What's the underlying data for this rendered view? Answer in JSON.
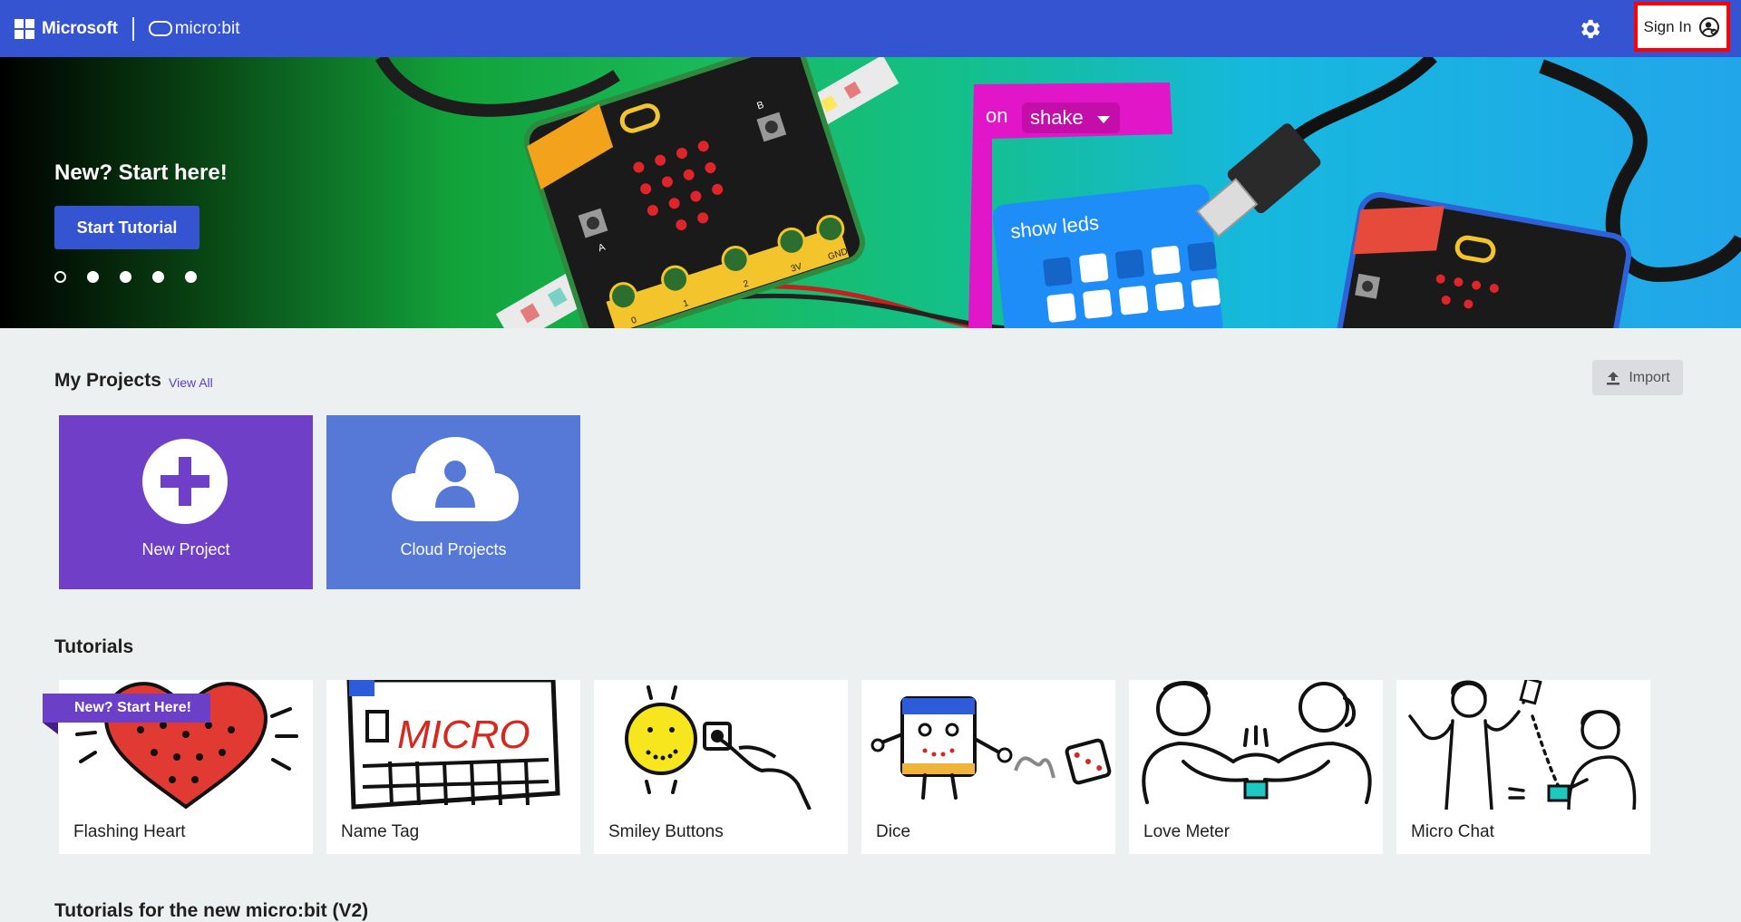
{
  "header": {
    "brand_microsoft": "Microsoft",
    "brand_product": "micro:bit",
    "settings_icon": "gear-icon",
    "signin_label": "Sign In",
    "signin_icon": "user-circle-icon",
    "bar_color": "#3454d1",
    "highlight_color": "#ff0000"
  },
  "hero": {
    "title": "New? Start here!",
    "button_label": "Start Tutorial",
    "carousel_count": 5,
    "carousel_active_index": 0,
    "art_labels": {
      "block_event": "on",
      "block_gesture": "shake",
      "block_show": "show leds",
      "pin_labels": [
        "0",
        "1",
        "2",
        "3V",
        "GND"
      ],
      "button_a": "A",
      "button_b": "B"
    }
  },
  "projects": {
    "title": "My Projects",
    "view_all": "View All",
    "import_label": "Import",
    "import_icon": "upload-icon",
    "cards": [
      {
        "label": "New Project",
        "icon": "plus-icon",
        "color": "#6f40c7"
      },
      {
        "label": "Cloud Projects",
        "icon": "cloud-user-icon",
        "color": "#5679d8"
      }
    ]
  },
  "tutorials": {
    "title": "Tutorials",
    "ribbon": "New? Start Here!",
    "cards": [
      {
        "label": "Flashing Heart"
      },
      {
        "label": "Name Tag"
      },
      {
        "label": "Smiley Buttons"
      },
      {
        "label": "Dice"
      },
      {
        "label": "Love Meter"
      },
      {
        "label": "Micro Chat"
      }
    ],
    "name_tag_art_text": "MICRO"
  },
  "next_section": {
    "title": "Tutorials for the new micro:bit (V2)"
  }
}
